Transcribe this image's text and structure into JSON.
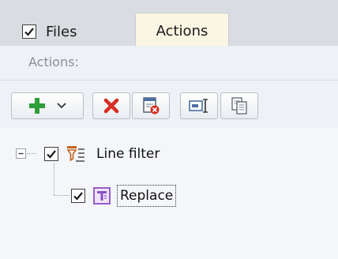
{
  "tabs": {
    "files": {
      "label": "Files",
      "checked": true
    },
    "actions": {
      "label": "Actions",
      "active": true
    }
  },
  "section": {
    "header": "Actions:"
  },
  "toolbar": {
    "buttons": [
      {
        "icon": "add-icon",
        "has_dropdown": true
      },
      {
        "icon": "delete-icon"
      },
      {
        "icon": "delete-all-icon"
      },
      {
        "icon": "rename-icon"
      },
      {
        "icon": "copy-icon"
      }
    ]
  },
  "tree": {
    "nodes": [
      {
        "label": "Line filter",
        "icon": "line-filter-icon",
        "checked": true,
        "expanded": true
      },
      {
        "label": "Replace",
        "icon": "replace-icon",
        "checked": true,
        "selected": true
      }
    ]
  },
  "colors": {
    "tabstrip_bg": "#d9dde2",
    "active_tab_bg": "#fbf5e3",
    "add_green": "#2e9e3a",
    "delete_red": "#d62d20",
    "filter_orange": "#c5621b",
    "replace_purple": "#8e4ec6"
  }
}
